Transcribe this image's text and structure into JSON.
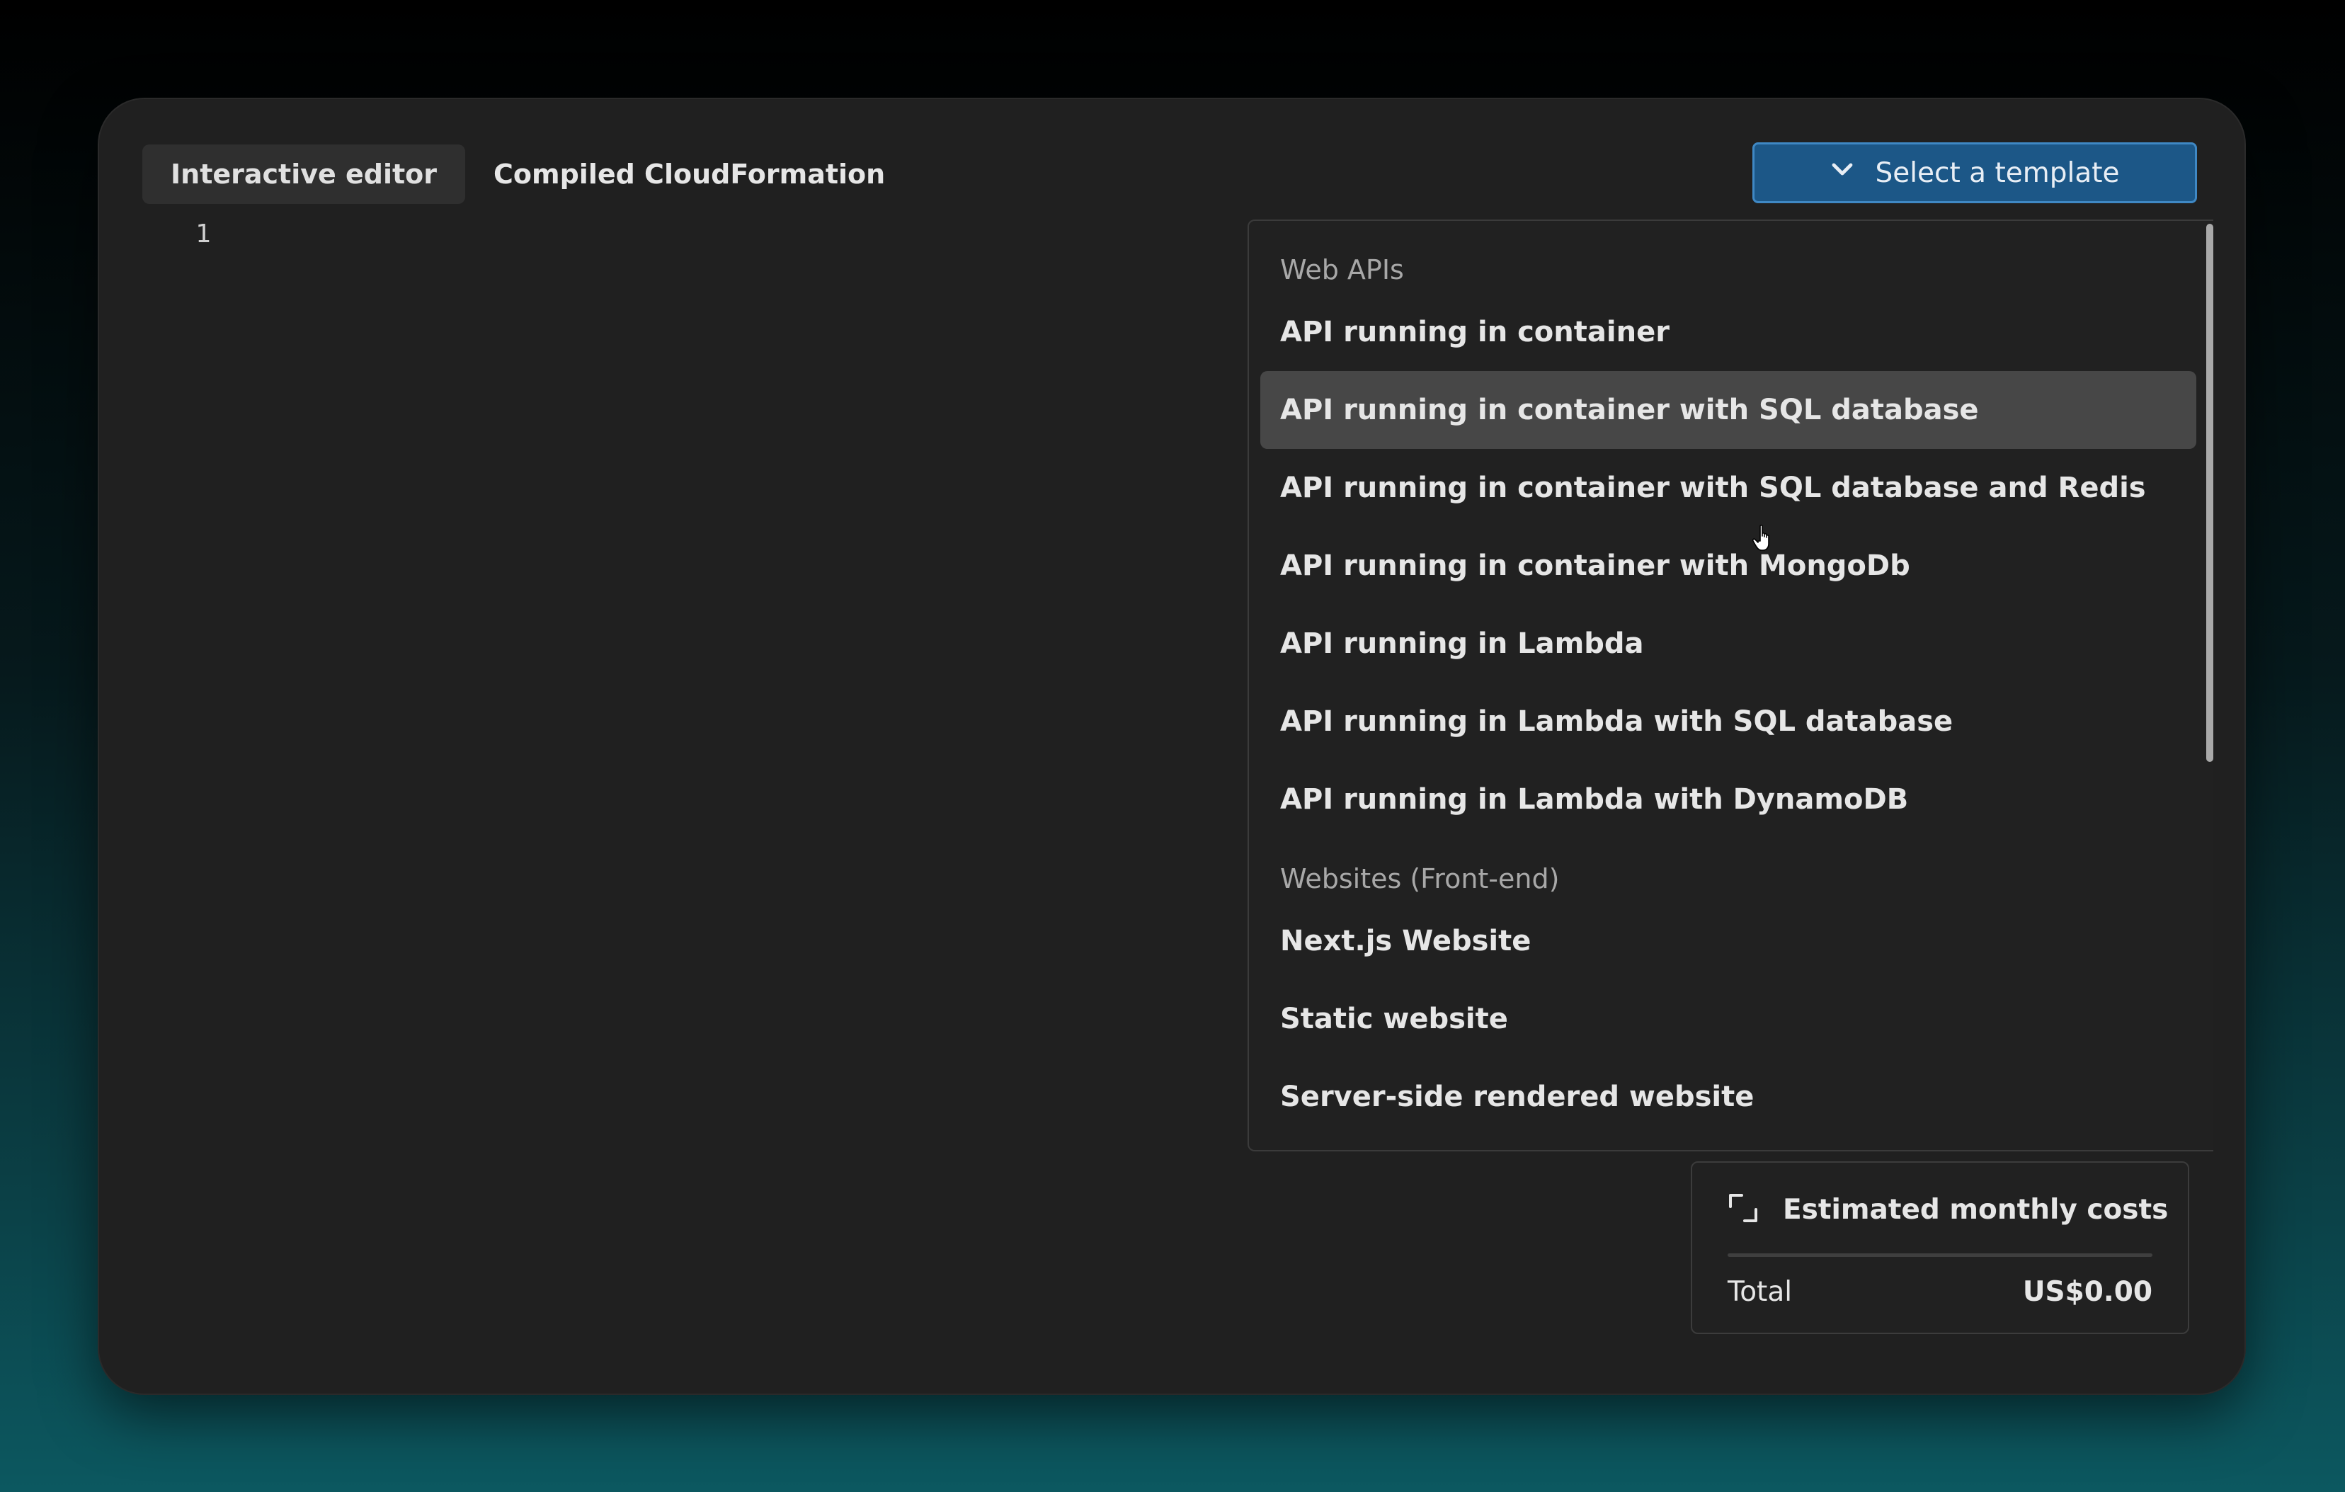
{
  "tabs": [
    {
      "label": "Interactive editor",
      "active": true
    },
    {
      "label": "Compiled CloudFormation",
      "active": false
    }
  ],
  "editor": {
    "line_numbers": [
      "1"
    ]
  },
  "template_select": {
    "label": "Select a template",
    "icon": "chevron-down-icon",
    "color": "#1c5787"
  },
  "dropdown": {
    "groups": [
      {
        "heading": "Web APIs",
        "options": [
          "API running in container",
          "API running in container with SQL database",
          "API running in container with SQL database and Redis",
          "API running in container with MongoDb",
          "API running in Lambda",
          "API running in Lambda with SQL database",
          "API running in Lambda with DynamoDB"
        ]
      },
      {
        "heading": "Websites (Front-end)",
        "options": [
          "Next.js Website",
          "Static website",
          "Server-side rendered website"
        ]
      }
    ],
    "highlighted_option": "API running in container with SQL database"
  },
  "costs": {
    "icon": "expand-icon",
    "title": "Estimated monthly costs",
    "total_label": "Total",
    "total_value": "US$0.00"
  }
}
